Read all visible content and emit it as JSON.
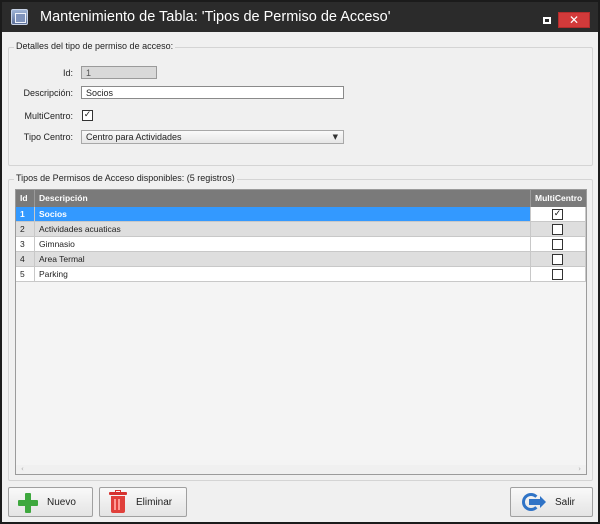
{
  "window": {
    "title": "Mantenimiento de Tabla: 'Tipos de Permiso de Acceso'",
    "app_icon": "table-maintenance-icon",
    "restore_icon": "restore-icon",
    "close_icon": "close-icon",
    "close_glyph": "✕"
  },
  "details": {
    "group_title": "Detalles del tipo de permiso de acceso:",
    "id_label": "Id:",
    "id_value": "1",
    "descripcion_label": "Descripción:",
    "descripcion_value": "Socios",
    "multicentro_label": "MultiCentro:",
    "multicentro_checked": true,
    "check_glyph": "✓",
    "tipo_centro_label": "Tipo Centro:",
    "tipo_centro_value": "Centro para Actividades",
    "chevron": "▼"
  },
  "list": {
    "group_title": "Tipos de Permisos de Acceso disponibles:  (5 registros)",
    "columns": [
      "Id",
      "Descripción",
      "MultiCentro"
    ],
    "rows": [
      {
        "id": "1",
        "descripcion": "Socios",
        "multicentro": true,
        "selected": true
      },
      {
        "id": "2",
        "descripcion": "Actividades acuaticas",
        "multicentro": false,
        "selected": false
      },
      {
        "id": "3",
        "descripcion": "Gimnasio",
        "multicentro": false,
        "selected": false
      },
      {
        "id": "4",
        "descripcion": "Area Termal",
        "multicentro": false,
        "selected": false
      },
      {
        "id": "5",
        "descripcion": "Parking",
        "multicentro": false,
        "selected": false
      }
    ],
    "scroll_left": "‹",
    "scroll_right": "›"
  },
  "buttons": {
    "nuevo_label": "Nuevo",
    "eliminar_label": "Eliminar",
    "salir_label": "Salir"
  },
  "colors": {
    "title_bar": "#2b2b2b",
    "close_button": "#d23a3a",
    "selected_row": "#3399ff",
    "grid_header": "#7a7a7a"
  }
}
